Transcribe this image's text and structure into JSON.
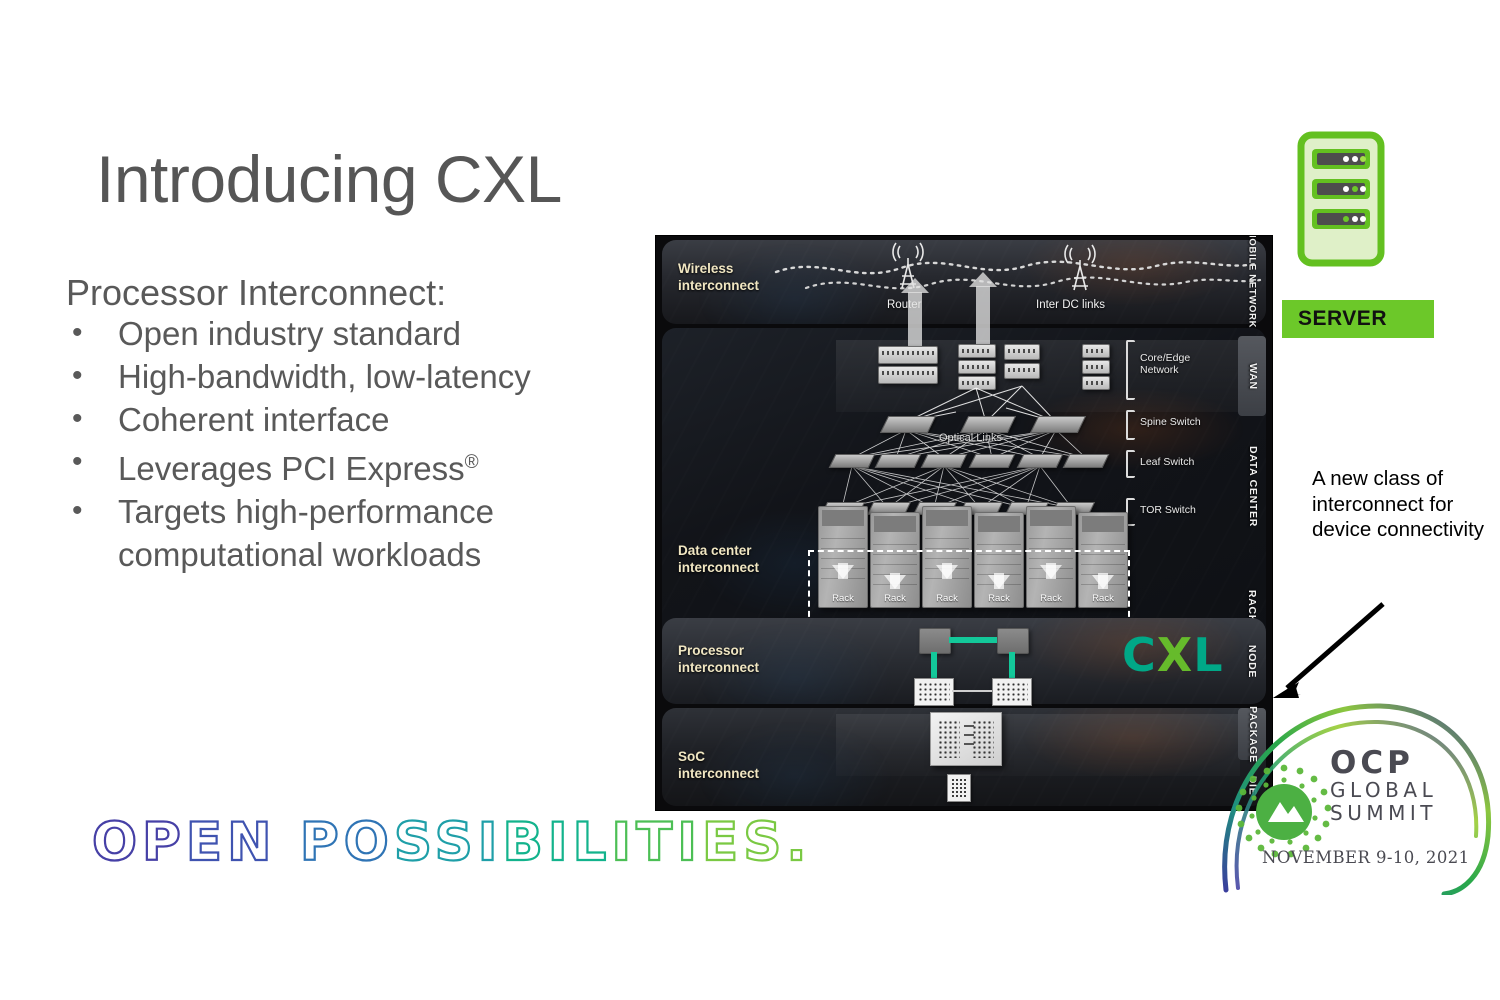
{
  "slide": {
    "title": "Introducing CXL",
    "lead": "Processor Interconnect:",
    "bullets": [
      "Open industry standard",
      "High-bandwidth, low-latency",
      "Coherent interface",
      "Leverages PCI Express",
      "Targets high-performance computational workloads"
    ],
    "pci_superscript": "®",
    "tagline": "OPEN POSSIBILITIES."
  },
  "diagram": {
    "rows": [
      {
        "label_line1": "Wireless",
        "label_line2": "interconnect",
        "scale": "MOBILE NETWORKS"
      },
      {
        "label_line1": "",
        "label_line2": "",
        "scale": "WAN"
      },
      {
        "label_line1": "Data center",
        "label_line2": "interconnect",
        "scale": "DATA CENTER"
      },
      {
        "label_line1": "",
        "label_line2": "",
        "scale": "RACK"
      },
      {
        "label_line1": "Processor",
        "label_line2": "interconnect",
        "scale": "NODE"
      },
      {
        "label_line1": "SoC",
        "label_line2": "interconnect",
        "scale": "PACKAGE"
      },
      {
        "label_line1": "",
        "label_line2": "",
        "scale": "DIE"
      }
    ],
    "scale_labels": {
      "mobile": "MOBILE NETWORKS",
      "wan": "WAN",
      "datacenter": "DATA CENTER",
      "rack": "RACK",
      "node": "NODE",
      "package": "PACKAGE",
      "die": "DIE"
    },
    "left_labels": {
      "wireless_1": "Wireless",
      "wireless_2": "interconnect",
      "datacenter_1": "Data center",
      "datacenter_2": "interconnect",
      "processor_1": "Processor",
      "processor_2": "interconnect",
      "soc_1": "SoC",
      "soc_2": "interconnect"
    },
    "inline_labels": {
      "router": "Router",
      "inter_dc_links": "Inter DC links",
      "optical_links": "Optical Links"
    },
    "braces": [
      "Core/Edge Network",
      "Spine Switch",
      "Leaf  Switch",
      "TOR Switch"
    ],
    "brace_core_line1": "Core/Edge",
    "brace_core_line2": "Network",
    "racks": [
      "Rack",
      "Rack",
      "Rack",
      "Rack",
      "Rack",
      "Rack"
    ],
    "cxl_logo": {
      "c": "C",
      "x": "X",
      "l": "L"
    },
    "colors": {
      "cxl_teal": "#00a887",
      "cxl_green": "#66bb2b",
      "label_cream": "#f0e6c2",
      "link_teal": "#13c89a"
    }
  },
  "right": {
    "server_label": "SERVER",
    "server_color": "#6cc829",
    "annotation": "A new class of interconnect for device connectivity"
  },
  "ocp": {
    "line1": "OCP",
    "line2": "GLOBAL",
    "line3": "SUMMIT",
    "date": "NOVEMBER 9-10, 2021"
  }
}
